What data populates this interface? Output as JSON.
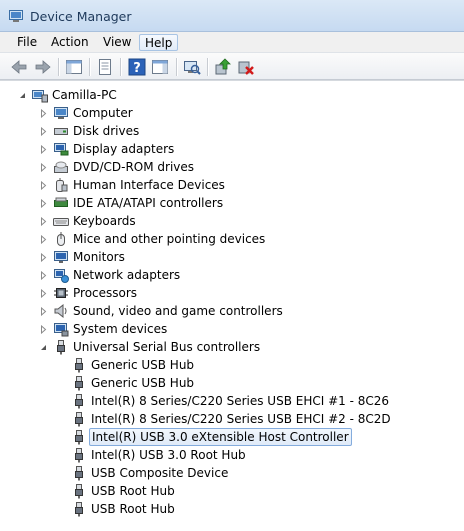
{
  "window": {
    "title": "Device Manager"
  },
  "menu": [
    "File",
    "Action",
    "View",
    "Help"
  ],
  "toolbar": [
    {
      "icon": "back-arrow-icon"
    },
    {
      "icon": "forward-arrow-icon"
    },
    {
      "icon": "show-hide-console-tree-icon"
    },
    {
      "icon": "properties-icon"
    },
    {
      "icon": "help-icon"
    },
    {
      "icon": "action-pane-icon"
    },
    {
      "icon": "scan-hardware-changes-icon"
    },
    {
      "icon": "update-driver-icon"
    },
    {
      "icon": "uninstall-device-icon"
    }
  ],
  "tree": {
    "root": "Camilla-PC",
    "categories": [
      {
        "label": "Computer",
        "icon": "computer-icon"
      },
      {
        "label": "Disk drives",
        "icon": "disk-drive-icon"
      },
      {
        "label": "Display adapters",
        "icon": "display-adapter-icon"
      },
      {
        "label": "DVD/CD-ROM drives",
        "icon": "dvd-drive-icon"
      },
      {
        "label": "Human Interface Devices",
        "icon": "hid-icon"
      },
      {
        "label": "IDE ATA/ATAPI controllers",
        "icon": "ide-controller-icon"
      },
      {
        "label": "Keyboards",
        "icon": "keyboard-icon"
      },
      {
        "label": "Mice and other pointing devices",
        "icon": "mouse-icon"
      },
      {
        "label": "Monitors",
        "icon": "monitor-icon"
      },
      {
        "label": "Network adapters",
        "icon": "network-adapter-icon"
      },
      {
        "label": "Processors",
        "icon": "processor-icon"
      },
      {
        "label": "Sound, video and game controllers",
        "icon": "sound-icon"
      },
      {
        "label": "System devices",
        "icon": "system-devices-icon"
      }
    ],
    "usb": {
      "label": "Universal Serial Bus controllers",
      "icon": "usb-controller-icon",
      "children": [
        "Generic USB Hub",
        "Generic USB Hub",
        "Intel(R) 8 Series/C220 Series USB EHCI #1 - 8C26",
        "Intel(R) 8 Series/C220 Series USB EHCI #2 - 8C2D",
        "Intel(R) USB 3.0 eXtensible Host Controller",
        "Intel(R) USB 3.0 Root Hub",
        "USB Composite Device",
        "USB Root Hub",
        "USB Root Hub"
      ],
      "selected_index": 4
    }
  }
}
